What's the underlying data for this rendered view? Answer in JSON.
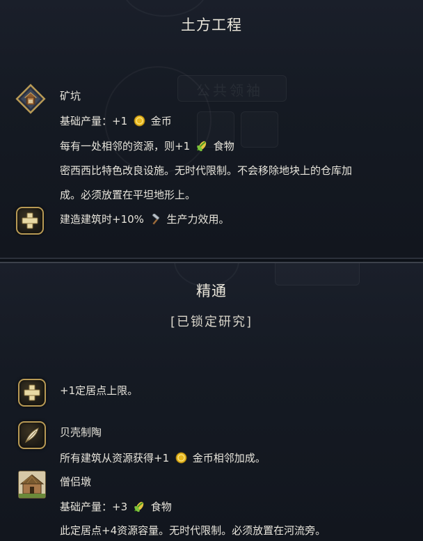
{
  "top_panel": {
    "title": "土方工程",
    "bg_ghost_text": "公共领袖",
    "improvement": {
      "icon": "well-building-icon",
      "name": "矿坑",
      "yield_label": "基础产量：+1",
      "yield_resource": "金币",
      "adjacency_prefix": "每有一处相邻的资源，则+1",
      "adjacency_resource": "食物",
      "desc_line1": "密西西比特色改良设施。无时代限制。不会移除地块上的仓库加",
      "desc_line2": "成。必须放置在平坦地形上。"
    },
    "bonus": {
      "icon": "plus-icon",
      "prefix": "建造建筑时+10%",
      "suffix": "生产力效用。"
    }
  },
  "bottom_panel": {
    "title": "精通",
    "status": "[已锁定研究]",
    "items": [
      {
        "icon": "plus-icon",
        "text": "+1定居点上限。"
      },
      {
        "icon": "feather-icon",
        "name": "贝壳制陶",
        "prefix": "所有建筑从资源获得+1",
        "suffix": "金币相邻加成。"
      },
      {
        "icon": "hut-building-icon",
        "name": "僧侣墩",
        "yield_label": "基础产量：+3",
        "yield_resource": "食物",
        "desc": "此定居点+4资源容量。无时代限制。必须放置在河流旁。"
      }
    ]
  },
  "colors": {
    "gold_frame": "#b89a55",
    "coin": "#e8b820",
    "food_leaf": "#7cc43a",
    "text": "#e8e5dc"
  }
}
